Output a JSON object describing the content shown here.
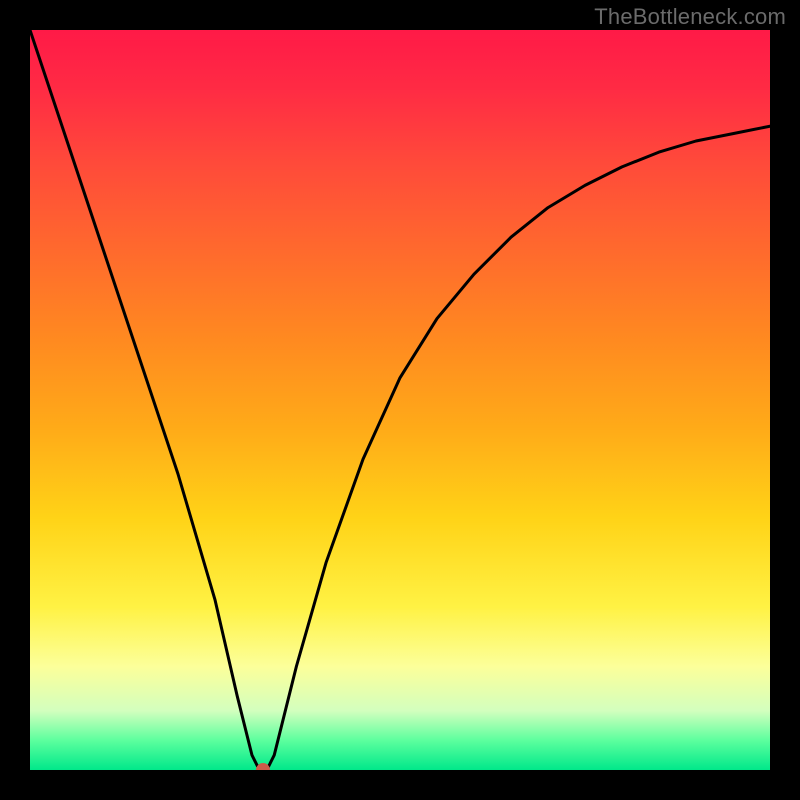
{
  "watermark": "TheBottleneck.com",
  "chart_data": {
    "type": "line",
    "title": "",
    "xlabel": "",
    "ylabel": "",
    "xlim": [
      0,
      100
    ],
    "ylim": [
      0,
      100
    ],
    "grid": false,
    "legend": false,
    "series": [
      {
        "name": "bottleneck-curve",
        "x": [
          0,
          5,
          10,
          15,
          20,
          25,
          28,
          30,
          31,
          32,
          33,
          34,
          36,
          40,
          45,
          50,
          55,
          60,
          65,
          70,
          75,
          80,
          85,
          90,
          95,
          100
        ],
        "y": [
          100,
          85,
          70,
          55,
          40,
          23,
          10,
          2,
          0,
          0,
          2,
          6,
          14,
          28,
          42,
          53,
          61,
          67,
          72,
          76,
          79,
          81.5,
          83.5,
          85,
          86,
          87
        ]
      }
    ],
    "marker": {
      "x": 31.5,
      "y": 0,
      "color": "#cc5a4a"
    },
    "background_gradient": {
      "top": "#ff1a47",
      "bottom": "#00e88a",
      "meaning": "red high → green low (bottleneck severity)"
    }
  }
}
